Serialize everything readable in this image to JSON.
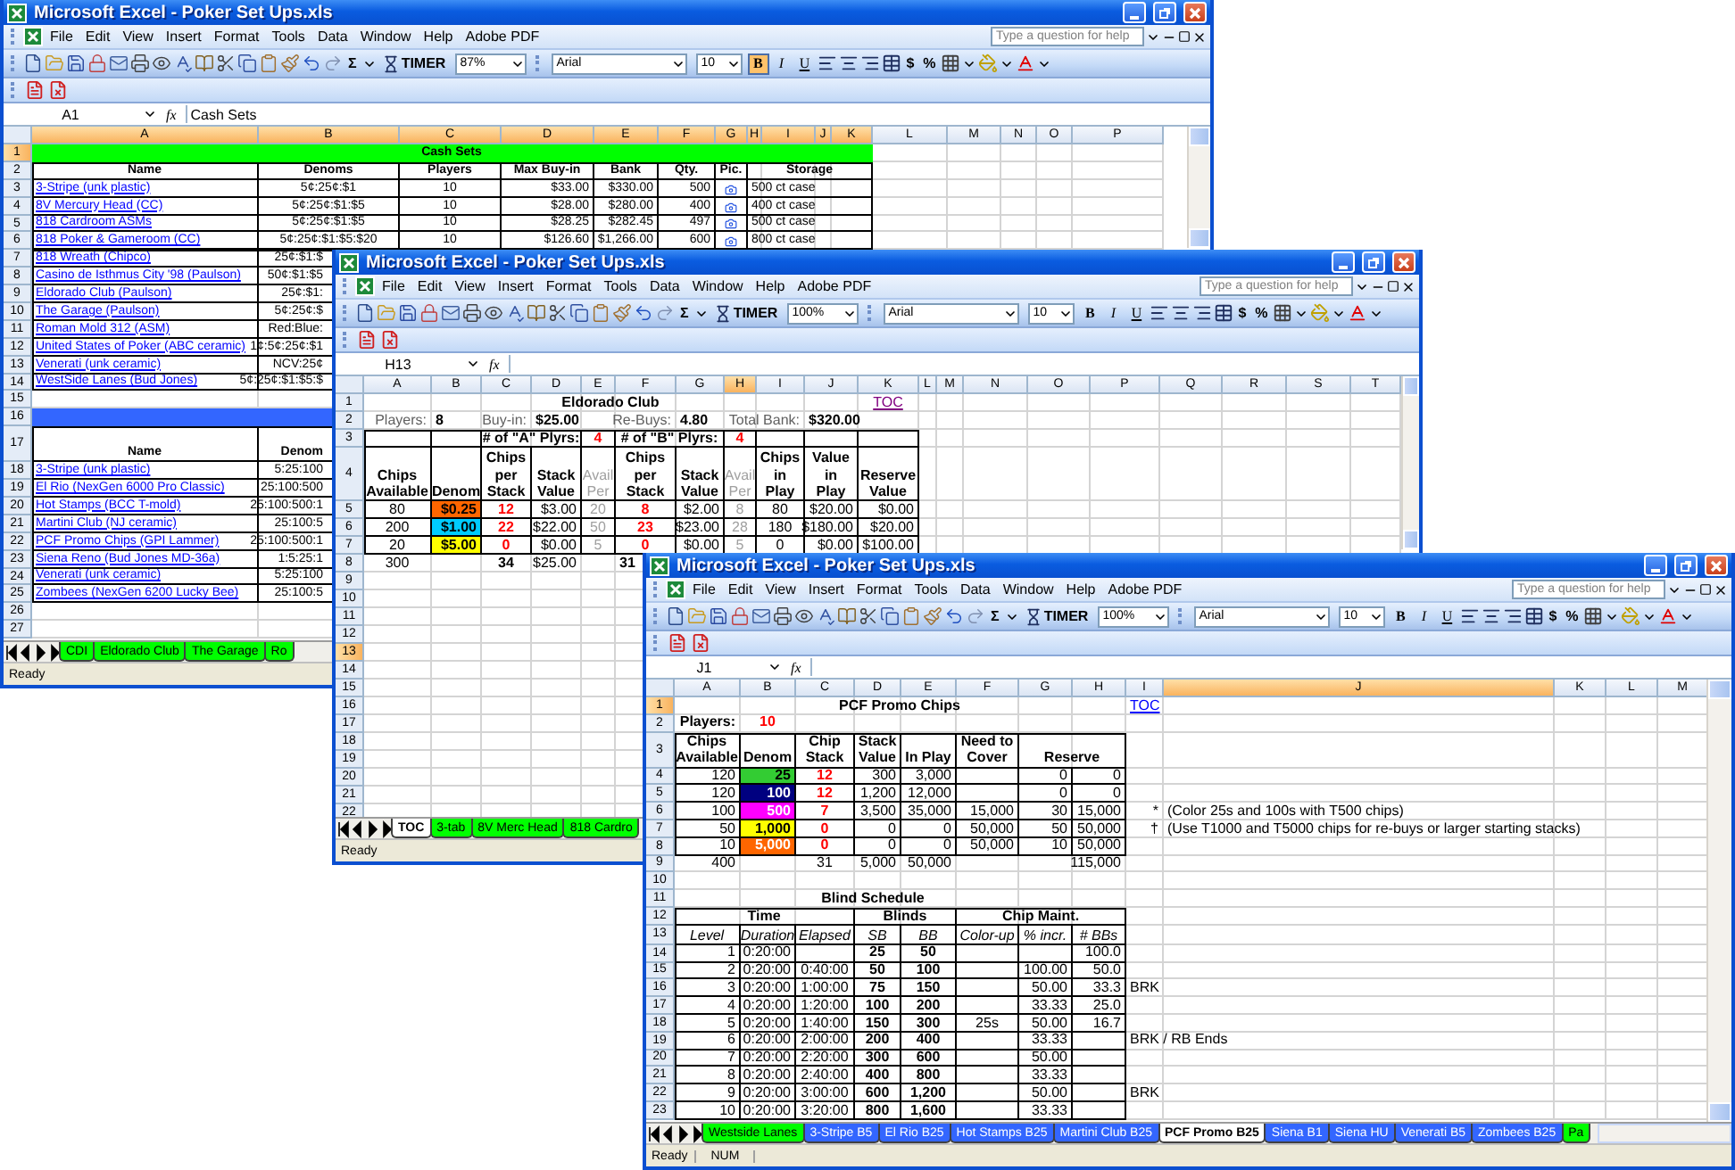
{
  "windows": [
    {
      "title": "Microsoft Excel - Poker Set Ups.xls",
      "menu": [
        "File",
        "Edit",
        "View",
        "Insert",
        "Format",
        "Tools",
        "Data",
        "Window",
        "Help",
        "Adobe PDF"
      ],
      "help_placeholder": "Type a question for help",
      "toolbar": {
        "sum": "Σ",
        "timer": "TIMER",
        "zoom": "87%",
        "font": "Arial",
        "font_size": "10",
        "format_buttons": [
          {
            "label": "B",
            "selected": true
          },
          {
            "label": "I",
            "selected": false
          },
          {
            "label": "U",
            "selected": false
          }
        ],
        "number_buttons": [
          "$",
          "%"
        ]
      },
      "name_box": "A1",
      "fx": "fx",
      "formula": "Cash Sets",
      "columns": [
        {
          "label": "A",
          "selected": true
        },
        {
          "label": "B",
          "selected": true
        },
        {
          "label": "C",
          "selected": true
        },
        {
          "label": "D",
          "selected": true
        },
        {
          "label": "E",
          "selected": true
        },
        {
          "label": "F",
          "selected": true
        },
        {
          "label": "G",
          "selected": true
        },
        {
          "label": "H",
          "selected": true
        },
        {
          "label": "I",
          "selected": true
        },
        {
          "label": "J",
          "selected": true
        },
        {
          "label": "K",
          "selected": true
        },
        {
          "label": "L",
          "selected": false
        },
        {
          "label": "M",
          "selected": false
        },
        {
          "label": "N",
          "selected": false
        },
        {
          "label": "O",
          "selected": false
        },
        {
          "label": "P",
          "selected": false
        }
      ],
      "rows": [
        {
          "n": "1",
          "selected": true,
          "cells": [
            {
              "text": "Cash Sets",
              "kind": "title",
              "colspan": 11,
              "color": "#00ff00"
            }
          ]
        },
        {
          "n": "2",
          "selected": false,
          "cells": [
            {
              "text": "Name",
              "kind": "head"
            },
            {
              "text": "Denoms",
              "kind": "head"
            },
            {
              "text": "Players",
              "kind": "head"
            },
            {
              "text": "Max Buy-in",
              "kind": "head"
            },
            {
              "text": "Bank",
              "kind": "head"
            },
            {
              "text": "Qty.",
              "kind": "head"
            },
            {
              "text": "Pic.",
              "kind": "head"
            },
            {
              "text": "Storage",
              "kind": "head",
              "colspan": 4
            }
          ]
        },
        {
          "n": "3",
          "selected": false,
          "cells": [
            {
              "text": "3-Stripe (unk plastic)",
              "kind": "link"
            },
            "5¢:25¢:$1",
            "10",
            "$33.00",
            "$330.00",
            "500",
            {
              "kind": "pic"
            },
            {
              "text": "500 ct case",
              "colspan": 4
            }
          ]
        },
        {
          "n": "4",
          "selected": false,
          "cells": [
            {
              "text": "8V Mercury Head (CC)",
              "kind": "link"
            },
            "5¢:25¢:$1:$5",
            "10",
            "$28.00",
            "$280.00",
            "400",
            {
              "kind": "pic"
            },
            {
              "text": "400 ct case",
              "colspan": 4
            }
          ]
        },
        {
          "n": "5",
          "selected": false,
          "cells": [
            {
              "text": "818 Cardroom ASMs",
              "kind": "link"
            },
            "5¢:25¢:$1:$5",
            "10",
            "$28.25",
            "$282.45",
            "497",
            {
              "kind": "pic"
            },
            {
              "text": "500 ct case",
              "colspan": 4
            }
          ]
        },
        {
          "n": "6",
          "selected": false,
          "cells": [
            {
              "text": "818 Poker & Gameroom (CC)",
              "kind": "link"
            },
            "5¢:25¢:$1:$5:$20",
            "10",
            "$126.60",
            "$1,266.00",
            "600",
            {
              "kind": "pic"
            },
            {
              "text": "800 ct case",
              "colspan": 4
            }
          ]
        },
        {
          "n": "7",
          "selected": false,
          "cells": [
            {
              "text": "818 Wreath (Chipco)",
              "kind": "link"
            },
            "25¢:$1:$"
          ]
        },
        {
          "n": "8",
          "selected": false,
          "cells": [
            {
              "text": "Casino de Isthmus City '98 (Paulson)",
              "kind": "link"
            },
            "50¢:$1:$5"
          ]
        },
        {
          "n": "9",
          "selected": false,
          "cells": [
            {
              "text": "Eldorado Club (Paulson)",
              "kind": "link"
            },
            "25¢:$1:"
          ]
        },
        {
          "n": "10",
          "selected": false,
          "cells": [
            {
              "text": "The Garage (Paulson)",
              "kind": "link"
            },
            "5¢:25¢:$"
          ]
        },
        {
          "n": "11",
          "selected": false,
          "cells": [
            {
              "text": "Roman Mold 312 (ASM)",
              "kind": "link"
            },
            "Red:Blue:"
          ]
        },
        {
          "n": "12",
          "selected": false,
          "cells": [
            {
              "text": "United States of Poker (ABC ceramic)",
              "kind": "link"
            },
            "1¢:5¢:25¢:$1"
          ]
        },
        {
          "n": "13",
          "selected": false,
          "cells": [
            {
              "text": "Venerati (unk ceramic)",
              "kind": "link"
            },
            "NCV:25¢"
          ]
        },
        {
          "n": "14",
          "selected": false,
          "cells": [
            {
              "text": "WestSide Lanes (Bud Jones)",
              "kind": "link"
            },
            "5¢:25¢:$1:$5:$"
          ]
        },
        {
          "n": "15",
          "selected": false,
          "cells": []
        },
        {
          "n": "16",
          "selected": false,
          "cells": [
            {
              "kind": "bar",
              "colspan": 11,
              "color": "#3366ff"
            }
          ]
        },
        {
          "n": "17",
          "selected": false,
          "cells": [
            {
              "text": "Name",
              "kind": "head"
            },
            {
              "text": "Denom",
              "kind": "head"
            }
          ]
        },
        {
          "n": "18",
          "selected": false,
          "cells": [
            {
              "text": "3-Stripe (unk plastic)",
              "kind": "link"
            },
            "5:25:100"
          ]
        },
        {
          "n": "19",
          "selected": false,
          "cells": [
            {
              "text": "El Rio (NexGen 6000 Pro Classic)",
              "kind": "link"
            },
            "25:100:500"
          ]
        },
        {
          "n": "20",
          "selected": false,
          "cells": [
            {
              "text": "Hot Stamps (BCC T-mold)",
              "kind": "link"
            },
            "25:100:500:1"
          ]
        },
        {
          "n": "21",
          "selected": false,
          "cells": [
            {
              "text": "Martini Club (NJ ceramic)",
              "kind": "link"
            },
            "25:100:5"
          ]
        },
        {
          "n": "22",
          "selected": false,
          "cells": [
            {
              "text": "PCF Promo Chips (GPI Lammer)",
              "kind": "link"
            },
            "25:100:500:1"
          ]
        },
        {
          "n": "23",
          "selected": false,
          "cells": [
            {
              "text": "Siena Reno (Bud Jones MD-36a)",
              "kind": "link"
            },
            "1:5:25:1"
          ]
        },
        {
          "n": "24",
          "selected": false,
          "cells": [
            {
              "text": "Venerati (unk ceramic)",
              "kind": "link"
            },
            "5:25:100"
          ]
        },
        {
          "n": "25",
          "selected": false,
          "cells": [
            {
              "text": "Zombees (NexGen 6200 Lucky Bee)",
              "kind": "link"
            },
            "25:100:5"
          ]
        },
        {
          "n": "26",
          "selected": false,
          "cells": []
        },
        {
          "n": "27",
          "selected": false,
          "cells": []
        }
      ],
      "sheet_tabs": [
        {
          "label": "CDI",
          "selected": false,
          "color": "#00ff00"
        },
        {
          "label": "Eldorado Club",
          "selected": false,
          "color": "#00ff00"
        },
        {
          "label": "The Garage",
          "selected": false,
          "color": "#00ff00"
        },
        {
          "label": "Ro",
          "selected": false,
          "color": "#00ff00"
        }
      ],
      "status": "Ready"
    },
    {
      "title": "Microsoft Excel - Poker Set Ups.xls",
      "menu": [
        "File",
        "Edit",
        "View",
        "Insert",
        "Format",
        "Tools",
        "Data",
        "Window",
        "Help",
        "Adobe PDF"
      ],
      "help_placeholder": "Type a question for help",
      "toolbar": {
        "sum": "Σ",
        "timer": "TIMER",
        "zoom": "100%",
        "font": "Arial",
        "font_size": "10",
        "format_buttons": [
          {
            "label": "B",
            "selected": false
          },
          {
            "label": "I",
            "selected": false
          },
          {
            "label": "U",
            "selected": false
          }
        ],
        "number_buttons": [
          "$",
          "%"
        ]
      },
      "name_box": "H13",
      "fx": "fx",
      "columns": [
        {
          "label": "A",
          "selected": false
        },
        {
          "label": "B",
          "selected": false
        },
        {
          "label": "C",
          "selected": false
        },
        {
          "label": "D",
          "selected": false
        },
        {
          "label": "E",
          "selected": false
        },
        {
          "label": "F",
          "selected": false
        },
        {
          "label": "G",
          "selected": false
        },
        {
          "label": "H",
          "selected": true
        },
        {
          "label": "I",
          "selected": false
        },
        {
          "label": "J",
          "selected": false
        },
        {
          "label": "K",
          "selected": false
        },
        {
          "label": "L",
          "selected": false
        },
        {
          "label": "M",
          "selected": false
        },
        {
          "label": "N",
          "selected": false
        },
        {
          "label": "O",
          "selected": false
        },
        {
          "label": "P",
          "selected": false
        },
        {
          "label": "Q",
          "selected": false
        },
        {
          "label": "R",
          "selected": false
        },
        {
          "label": "S",
          "selected": false
        },
        {
          "label": "T",
          "selected": false
        }
      ],
      "rows": [
        {
          "n": "1",
          "selected": false,
          "cells": [
            {
              "text": "Eldorado Club",
              "kind": "title",
              "colspan": 10
            },
            {
              "text": "TOC",
              "kind": "visited"
            }
          ]
        },
        {
          "n": "2",
          "selected": false,
          "cells": [
            {
              "text": "Players:",
              "kind": "label"
            },
            {
              "text": "8",
              "kind": "value"
            },
            {
              "text": "Buy-in:",
              "kind": "label"
            },
            {
              "text": "$25.00",
              "kind": "value"
            },
            null,
            {
              "text": "Re-Buys:",
              "kind": "label"
            },
            {
              "text": "4.80",
              "kind": "value"
            },
            null,
            {
              "text": "Total Bank:",
              "kind": "label"
            },
            {
              "text": "$320.00",
              "kind": "value"
            }
          ]
        },
        {
          "n": "3",
          "selected": false,
          "cells": [
            null,
            null,
            {
              "text": "# of \"A\" Plyrs:",
              "kind": "bold",
              "colspan": 2
            },
            {
              "text": "4",
              "kind": "red"
            },
            {
              "text": "# of \"B\" Plyrs:",
              "kind": "bold",
              "colspan": 2
            },
            {
              "text": "4",
              "kind": "red"
            }
          ]
        },
        {
          "n": "4",
          "selected": false,
          "cells": [
            {
              "text": "Chips Available",
              "kind": "head"
            },
            {
              "text": "Denom",
              "kind": "head"
            },
            {
              "text": "Chips per Stack",
              "kind": "head"
            },
            {
              "text": "Stack Value",
              "kind": "head"
            },
            {
              "text": "Avail Per",
              "kind": "greyhead"
            },
            {
              "text": "Chips per Stack",
              "kind": "head"
            },
            {
              "text": "Stack Value",
              "kind": "head"
            },
            {
              "text": "Avail Per",
              "kind": "greyhead"
            },
            {
              "text": "Chips in Play",
              "kind": "head"
            },
            {
              "text": "Value in Play",
              "kind": "head"
            },
            {
              "text": "Reserve Value",
              "kind": "head"
            }
          ]
        },
        {
          "n": "5",
          "selected": false,
          "cells": [
            "80",
            {
              "text": "$0.25",
              "kind": "bold",
              "color": "#ff6600"
            },
            {
              "text": "12",
              "kind": "red"
            },
            "$3.00",
            {
              "text": "20",
              "kind": "grey"
            },
            {
              "text": "8",
              "kind": "red"
            },
            "$2.00",
            {
              "text": "8",
              "kind": "grey"
            },
            "80",
            "$20.00",
            "$0.00"
          ]
        },
        {
          "n": "6",
          "selected": false,
          "cells": [
            "200",
            {
              "text": "$1.00",
              "kind": "bold",
              "color": "#00ccff"
            },
            {
              "text": "22",
              "kind": "red"
            },
            "$22.00",
            {
              "text": "50",
              "kind": "grey"
            },
            {
              "text": "23",
              "kind": "red"
            },
            "$23.00",
            {
              "text": "28",
              "kind": "grey"
            },
            "180",
            "$180.00",
            "$20.00"
          ]
        },
        {
          "n": "7",
          "selected": false,
          "cells": [
            "20",
            {
              "text": "$5.00",
              "kind": "bold",
              "color": "#ffff00"
            },
            {
              "text": "0",
              "kind": "red"
            },
            "$0.00",
            {
              "text": "5",
              "kind": "grey"
            },
            {
              "text": "0",
              "kind": "red"
            },
            "$0.00",
            {
              "text": "5",
              "kind": "grey"
            },
            "0",
            "$0.00",
            "$100.00"
          ]
        },
        {
          "n": "8",
          "selected": false,
          "cells": [
            "300",
            null,
            {
              "text": "34",
              "kind": "boldc"
            },
            "$25.00",
            null,
            {
              "text": "31",
              "kind": "boldl"
            }
          ]
        },
        {
          "n": "9",
          "selected": false,
          "cells": []
        },
        {
          "n": "10",
          "selected": false,
          "cells": []
        },
        {
          "n": "11",
          "selected": false,
          "cells": []
        },
        {
          "n": "12",
          "selected": false,
          "cells": []
        },
        {
          "n": "13",
          "selected": true,
          "cells": []
        },
        {
          "n": "14",
          "selected": false,
          "cells": []
        },
        {
          "n": "15",
          "selected": false,
          "cells": []
        },
        {
          "n": "16",
          "selected": false,
          "cells": []
        },
        {
          "n": "17",
          "selected": false,
          "cells": []
        },
        {
          "n": "18",
          "selected": false,
          "cells": []
        },
        {
          "n": "19",
          "selected": false,
          "cells": []
        },
        {
          "n": "20",
          "selected": false,
          "cells": []
        },
        {
          "n": "21",
          "selected": false,
          "cells": []
        },
        {
          "n": "22",
          "selected": false,
          "cells": []
        }
      ],
      "sheet_tabs": [
        {
          "label": "TOC",
          "selected": true
        },
        {
          "label": "3-tab",
          "selected": false,
          "color": "#00ff00"
        },
        {
          "label": "8V Merc Head",
          "selected": false,
          "color": "#00ff00"
        },
        {
          "label": "818 Cardro",
          "selected": false,
          "color": "#00ff00"
        }
      ],
      "status": "Ready"
    },
    {
      "title": "Microsoft Excel - Poker Set Ups.xls",
      "menu": [
        "File",
        "Edit",
        "View",
        "Insert",
        "Format",
        "Tools",
        "Data",
        "Window",
        "Help",
        "Adobe PDF"
      ],
      "help_placeholder": "Type a question for help",
      "toolbar": {
        "sum": "Σ",
        "timer": "TIMER",
        "zoom": "100%",
        "font": "Arial",
        "font_size": "10",
        "format_buttons": [
          {
            "label": "B",
            "selected": false
          },
          {
            "label": "I",
            "selected": false
          },
          {
            "label": "U",
            "selected": false
          }
        ],
        "number_buttons": [
          "$",
          "%"
        ]
      },
      "name_box": "J1",
      "fx": "fx",
      "columns": [
        {
          "label": "A",
          "selected": false
        },
        {
          "label": "B",
          "selected": false
        },
        {
          "label": "C",
          "selected": false
        },
        {
          "label": "D",
          "selected": false
        },
        {
          "label": "E",
          "selected": false
        },
        {
          "label": "F",
          "selected": false
        },
        {
          "label": "G",
          "selected": false
        },
        {
          "label": "H",
          "selected": false
        },
        {
          "label": "I",
          "selected": false
        },
        {
          "label": "J",
          "selected": true
        },
        {
          "label": "K",
          "selected": false
        },
        {
          "label": "L",
          "selected": false
        },
        {
          "label": "M",
          "selected": false
        }
      ],
      "rows": [
        {
          "n": "1",
          "selected": true,
          "cells": [
            {
              "text": "PCF Promo Chips",
              "kind": "title",
              "colspan": 8
            },
            {
              "text": "TOC",
              "kind": "link"
            }
          ]
        },
        {
          "n": "2",
          "selected": false,
          "cells": [
            {
              "text": "Players:",
              "kind": "bold"
            },
            {
              "text": "10",
              "kind": "red"
            }
          ]
        },
        {
          "n": "3",
          "selected": false,
          "cells": [
            {
              "text": "Chips Available",
              "kind": "head"
            },
            {
              "text": "Denom",
              "kind": "head"
            },
            {
              "text": "Chip Stack",
              "kind": "head"
            },
            {
              "text": "Stack Value",
              "kind": "head"
            },
            {
              "text": "In Play",
              "kind": "head"
            },
            {
              "text": "Need to Cover",
              "kind": "head"
            },
            {
              "text": "Reserve",
              "kind": "head",
              "colspan": 2
            }
          ]
        },
        {
          "n": "4",
          "selected": false,
          "cells": [
            "120",
            {
              "text": "25",
              "kind": "bold",
              "color": "#33cc33"
            },
            {
              "text": "12",
              "kind": "red"
            },
            "300",
            "3,000",
            null,
            "0",
            "0"
          ]
        },
        {
          "n": "5",
          "selected": false,
          "cells": [
            "120",
            {
              "text": "100",
              "kind": "white",
              "color": "#000080"
            },
            {
              "text": "12",
              "kind": "red"
            },
            "1,200",
            "12,000",
            null,
            "0",
            "0"
          ]
        },
        {
          "n": "6",
          "selected": false,
          "cells": [
            "100",
            {
              "text": "500",
              "kind": "white",
              "color": "#ff00ff"
            },
            {
              "text": "7",
              "kind": "red"
            },
            "3,500",
            "35,000",
            "15,000",
            "30",
            "15,000",
            {
              "text": "*",
              "kind": "note"
            },
            "(Color 25s and 100s with T500 chips)"
          ]
        },
        {
          "n": "7",
          "selected": false,
          "cells": [
            "50",
            {
              "text": "1,000",
              "kind": "bold",
              "color": "#ffff00"
            },
            {
              "text": "0",
              "kind": "red"
            },
            "0",
            "0",
            "50,000",
            "50",
            "50,000",
            {
              "text": "†",
              "kind": "note"
            },
            "(Use T1000 and T5000 chips for re-buys or larger starting stacks)"
          ]
        },
        {
          "n": "8",
          "selected": false,
          "cells": [
            "10",
            {
              "text": "5,000",
              "kind": "white",
              "color": "#ff6600"
            },
            {
              "text": "0",
              "kind": "red"
            },
            "0",
            "0",
            "50,000",
            "10",
            "50,000"
          ]
        },
        {
          "n": "9",
          "selected": false,
          "cells": [
            "400",
            null,
            "31",
            "5,000",
            "50,000",
            null,
            null,
            "115,000"
          ]
        },
        {
          "n": "10",
          "selected": false,
          "cells": []
        },
        {
          "n": "11",
          "selected": false,
          "cells": [
            {
              "text": "Blind Schedule",
              "kind": "title",
              "colspan": 7
            }
          ]
        },
        {
          "n": "12",
          "selected": false,
          "cells": [
            {
              "text": "Time",
              "kind": "title",
              "colspan": 3
            },
            {
              "text": "Blinds",
              "kind": "title",
              "colspan": 2
            },
            {
              "text": "Chip Maint.",
              "kind": "title",
              "colspan": 3
            }
          ]
        },
        {
          "n": "13",
          "selected": false,
          "cells": [
            {
              "text": "Level",
              "kind": "italic"
            },
            {
              "text": "Duration",
              "kind": "italic"
            },
            {
              "text": "Elapsed",
              "kind": "italic"
            },
            {
              "text": "SB",
              "kind": "italic"
            },
            {
              "text": "BB",
              "kind": "italic"
            },
            {
              "text": "Color-up",
              "kind": "italic"
            },
            {
              "text": "% incr.",
              "kind": "italic"
            },
            {
              "text": "# BBs",
              "kind": "italic"
            }
          ]
        },
        {
          "n": "14",
          "selected": false,
          "cells": [
            "1",
            "0:20:00",
            null,
            {
              "text": "25",
              "kind": "boldc"
            },
            {
              "text": "50",
              "kind": "boldc"
            },
            null,
            null,
            "100.0"
          ]
        },
        {
          "n": "15",
          "selected": false,
          "cells": [
            "2",
            "0:20:00",
            "0:40:00",
            {
              "text": "50",
              "kind": "boldc"
            },
            {
              "text": "100",
              "kind": "boldc"
            },
            null,
            "100.00",
            "50.0"
          ]
        },
        {
          "n": "16",
          "selected": false,
          "cells": [
            "3",
            "0:20:00",
            "1:00:00",
            {
              "text": "75",
              "kind": "boldc"
            },
            {
              "text": "150",
              "kind": "boldc"
            },
            null,
            "50.00",
            "33.3",
            "BRK"
          ]
        },
        {
          "n": "17",
          "selected": false,
          "cells": [
            "4",
            "0:20:00",
            "1:20:00",
            {
              "text": "100",
              "kind": "boldc"
            },
            {
              "text": "200",
              "kind": "boldc"
            },
            null,
            "33.33",
            "25.0"
          ]
        },
        {
          "n": "18",
          "selected": false,
          "cells": [
            "5",
            "0:20:00",
            "1:40:00",
            {
              "text": "150",
              "kind": "boldc"
            },
            {
              "text": "300",
              "kind": "boldc"
            },
            {
              "text": "25s",
              "kind": "center"
            },
            "50.00",
            "16.7"
          ]
        },
        {
          "n": "19",
          "selected": false,
          "cells": [
            "6",
            "0:20:00",
            "2:00:00",
            {
              "text": "200",
              "kind": "boldc"
            },
            {
              "text": "400",
              "kind": "boldc"
            },
            null,
            "33.33",
            null,
            "BRK / RB Ends"
          ]
        },
        {
          "n": "20",
          "selected": false,
          "cells": [
            "7",
            "0:20:00",
            "2:20:00",
            {
              "text": "300",
              "kind": "boldc"
            },
            {
              "text": "600",
              "kind": "boldc"
            },
            null,
            "50.00"
          ]
        },
        {
          "n": "21",
          "selected": false,
          "cells": [
            "8",
            "0:20:00",
            "2:40:00",
            {
              "text": "400",
              "kind": "boldc"
            },
            {
              "text": "800",
              "kind": "boldc"
            },
            null,
            "33.33"
          ]
        },
        {
          "n": "22",
          "selected": false,
          "cells": [
            "9",
            "0:20:00",
            "3:00:00",
            {
              "text": "600",
              "kind": "boldc"
            },
            {
              "text": "1,200",
              "kind": "boldc"
            },
            null,
            "50.00",
            null,
            "BRK"
          ]
        },
        {
          "n": "23",
          "selected": false,
          "cells": [
            "10",
            "0:20:00",
            "3:20:00",
            {
              "text": "800",
              "kind": "boldc"
            },
            {
              "text": "1,600",
              "kind": "boldc"
            },
            null,
            "33.33"
          ]
        }
      ],
      "sheet_tabs": [
        {
          "label": "Westside Lanes",
          "selected": false,
          "color": "#00ff00"
        },
        {
          "label": "3-Stripe B5",
          "selected": false,
          "color": "#3366ff"
        },
        {
          "label": "El Rio B25",
          "selected": false,
          "color": "#3366ff"
        },
        {
          "label": "Hot Stamps B25",
          "selected": false,
          "color": "#3366ff"
        },
        {
          "label": "Martini Club B25",
          "selected": false,
          "color": "#3366ff"
        },
        {
          "label": "PCF Promo B25",
          "selected": true
        },
        {
          "label": "Siena B1",
          "selected": false,
          "color": "#3366ff"
        },
        {
          "label": "Siena HU",
          "selected": false,
          "color": "#3366ff"
        },
        {
          "label": "Venerati B5",
          "selected": false,
          "color": "#3366ff"
        },
        {
          "label": "Zombees B25",
          "selected": false,
          "color": "#3366ff"
        },
        {
          "label": "Pa",
          "selected": false,
          "color": "#00ff00"
        }
      ],
      "status": "Ready",
      "status_indicators": [
        "NUM"
      ]
    }
  ]
}
